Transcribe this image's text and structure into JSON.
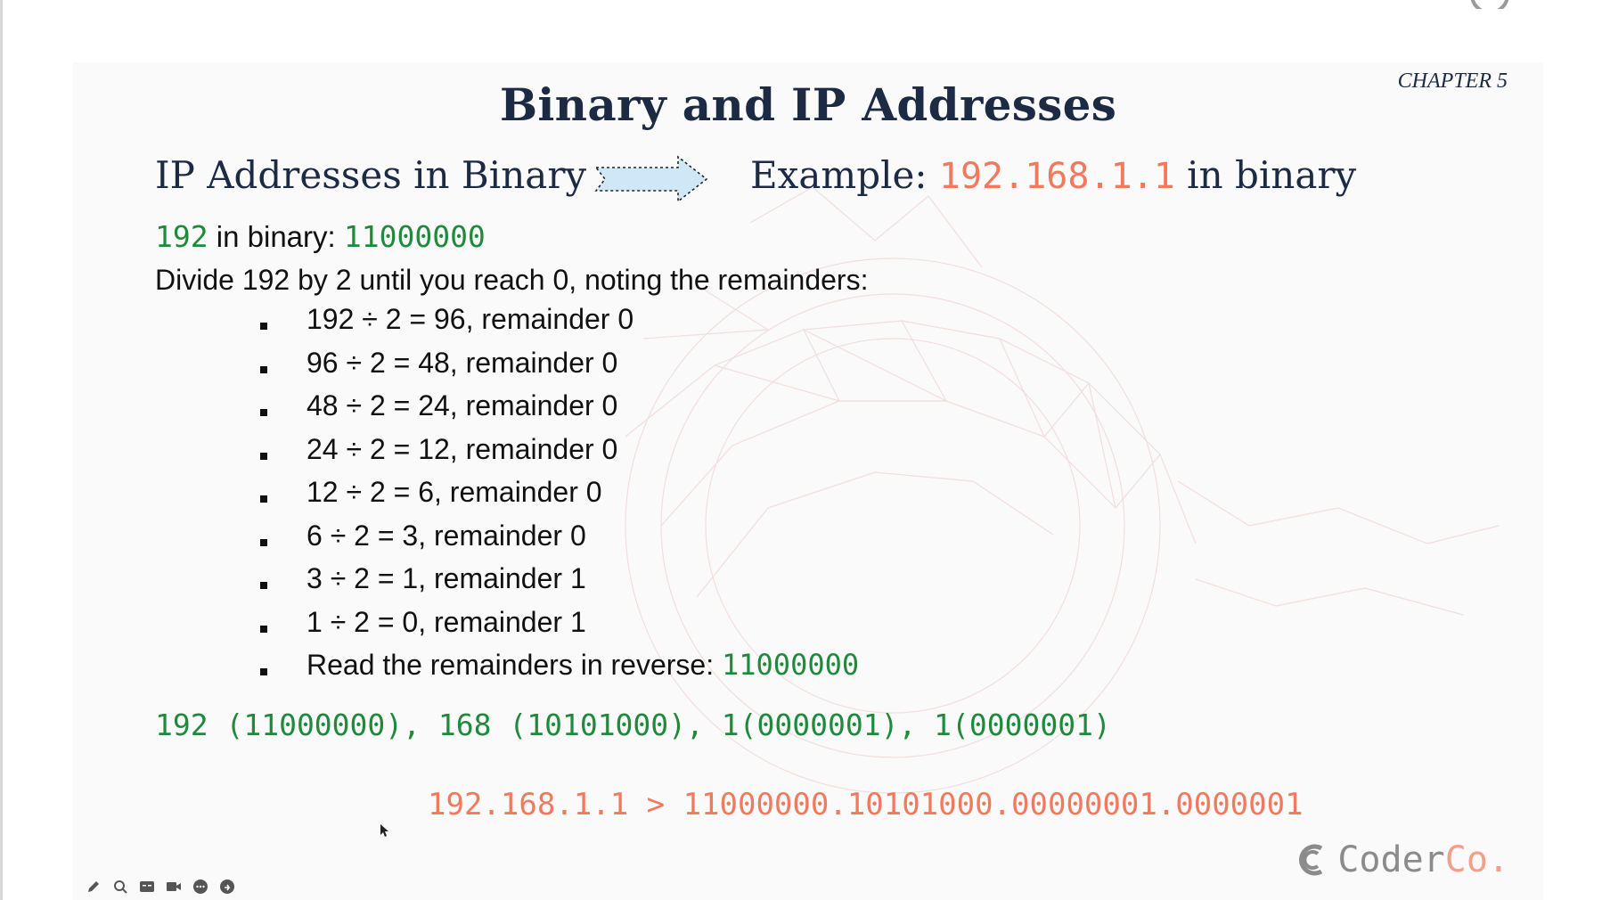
{
  "slide": {
    "title": "Binary and IP Addresses",
    "chapter": "CHAPTER 5",
    "subheading_left": "IP Addresses in Binary",
    "subheading_right": {
      "prefix": "Example: ",
      "ip": "192.168.1.1",
      "suffix": " in binary"
    },
    "binary_line": {
      "number": "192",
      "label": " in binary: ",
      "value": "11000000"
    },
    "instruction": "Divide 192 by 2 until you reach 0, noting the remainders:",
    "steps": [
      "192 ÷ 2 = 96, remainder 0",
      "96 ÷ 2 = 48, remainder 0",
      "48 ÷ 2 = 24, remainder 0",
      "24 ÷ 2 = 12, remainder 0",
      "12 ÷ 2 = 6, remainder 0",
      "6 ÷ 2 = 3, remainder 0",
      "3 ÷ 2 = 1, remainder 1",
      "1 ÷ 2 = 0, remainder 1"
    ],
    "reverse_step": {
      "text": "Read the remainders in reverse: ",
      "value": "11000000"
    },
    "summary": "192 (11000000), 168 (10101000), 1(0000001), 1(0000001)",
    "result": "192.168.1.1 > 11000000.10101000.00000001.0000001"
  },
  "logo": {
    "part1": "Coder",
    "part2": "Co."
  },
  "colors": {
    "title": "#1c2a44",
    "accent_salmon": "#f07a5d",
    "accent_green": "#1f8a3c",
    "arrow_fill": "#cfe8f7"
  },
  "toolbar": {
    "icons": [
      "pencil-icon",
      "search-icon",
      "captions-icon",
      "camera-icon",
      "chat-icon",
      "share-icon"
    ]
  }
}
